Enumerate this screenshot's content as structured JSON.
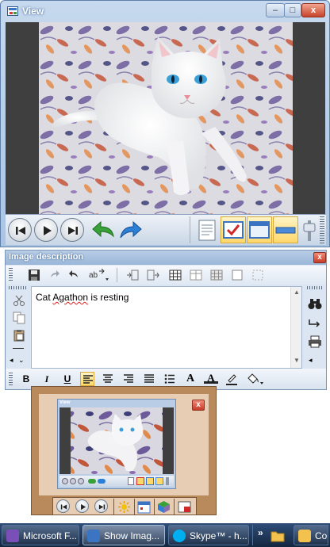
{
  "view_window": {
    "title": "View",
    "caption_buttons": {
      "minimize": "–",
      "maximize": "□",
      "close": "x"
    },
    "toolbar": {
      "nav": [
        {
          "name": "first-button",
          "icon": "skip-back-icon"
        },
        {
          "name": "play-button",
          "icon": "play-icon"
        },
        {
          "name": "last-button",
          "icon": "skip-forward-icon"
        }
      ],
      "actions": [
        {
          "name": "undo-button",
          "icon": "curved-arrow-left-icon",
          "color": "#3aa03a"
        },
        {
          "name": "redo-button",
          "icon": "curved-arrow-right-icon",
          "color": "#2b7fd6"
        }
      ],
      "tools": [
        {
          "name": "notes-button",
          "icon": "document-icon",
          "pressed": false
        },
        {
          "name": "check-button",
          "icon": "checkbox-icon",
          "pressed": true
        },
        {
          "name": "window-button",
          "icon": "window-icon",
          "pressed": true
        },
        {
          "name": "bar-button",
          "icon": "bar-icon",
          "pressed": true
        },
        {
          "name": "slider-button",
          "icon": "slider-icon",
          "pressed": false
        }
      ]
    }
  },
  "description_window": {
    "title": "Image description",
    "close_label": "x",
    "text_before": "Cat ",
    "text_misspelled": "Agathon",
    "text_after": " is resting",
    "format": {
      "bold": "B",
      "italic": "I",
      "underline": "U",
      "font_color_glyph": "A",
      "font_glyph": "A"
    }
  },
  "mini_preview": {
    "close_label": "x",
    "title": "View"
  },
  "taskbar": {
    "items": [
      {
        "label": "Microsoft F...",
        "color": "#7b4fb8",
        "active": false
      },
      {
        "label": "Show Imag...",
        "color": "#3c74c4",
        "active": true
      },
      {
        "label": "Skype™ - h...",
        "color": "#00aff0",
        "active": false
      }
    ],
    "overflow": "»",
    "tray_text": "Co"
  },
  "colors": {
    "accent_blue": "#3c74c4",
    "close_red": "#c83c28",
    "mini_frame": "#b88a5c",
    "pressed_yellow": "#ffd86b"
  }
}
